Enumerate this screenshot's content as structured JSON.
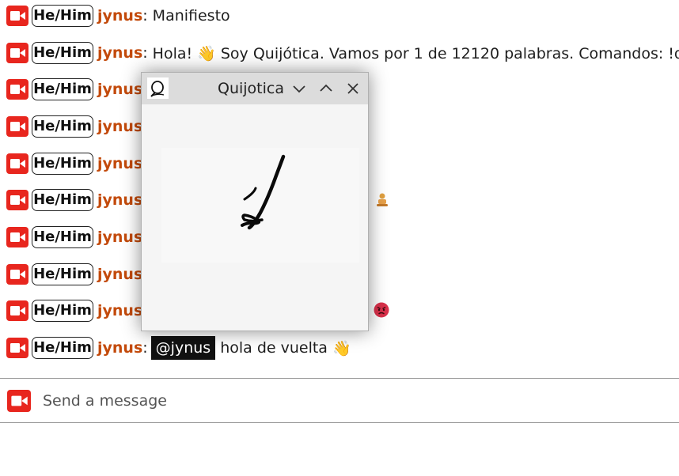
{
  "pronouns": "He/Him",
  "messages": [
    {
      "user": "jynus",
      "sep": ":",
      "text": "Manifiesto"
    },
    {
      "user": "jynus",
      "sep": ":",
      "text": "Hola! 👋 Soy Quijótica. Vamos por 1 de 12120 palabras. Comandos: !quijót"
    },
    {
      "user": "jynus",
      "sep": ":",
      "text": ""
    },
    {
      "user": "jynus",
      "sep": ":",
      "text": ""
    },
    {
      "user": "jynus",
      "sep": ":",
      "text": ""
    },
    {
      "user": "jynus",
      "sep": ":",
      "text": ""
    },
    {
      "user": "jynus",
      "sep": ":",
      "text": ""
    },
    {
      "user": "jynus",
      "sep": ":",
      "text": ""
    },
    {
      "user": "jynus",
      "sep": ":",
      "text": ""
    },
    {
      "user": "jynus",
      "sep": ":",
      "mention": "@jynus",
      "text": "hola de vuelta",
      "emoji": "👋"
    }
  ],
  "input": {
    "placeholder": "Send a message"
  },
  "popup": {
    "title": "Quijotica",
    "app_icon": "quill-q-icon",
    "buttons": [
      "minimize-chevron-down-icon",
      "maximize-chevron-up-icon",
      "close-icon"
    ],
    "canvas_content": "handwritten digit 1"
  },
  "colors": {
    "camera_icon": "#e8261e",
    "username": "#c34a0b",
    "mention_bg": "#111111",
    "titlebar": "#dcdcdc"
  }
}
